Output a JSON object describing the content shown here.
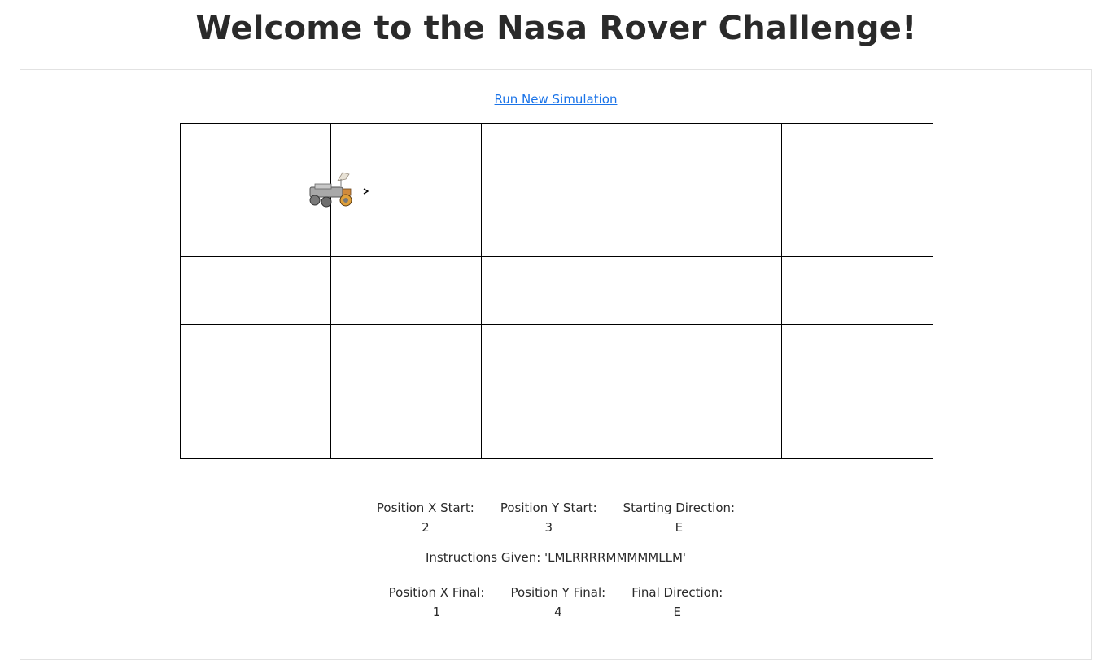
{
  "page": {
    "title": "Welcome to the Nasa Rover Challenge!"
  },
  "actions": {
    "run_label": "Run New Simulation"
  },
  "grid": {
    "columns": 5,
    "rows": 5,
    "rover_direction": "E",
    "rover_icon": "rover-icon"
  },
  "start": {
    "x_label": "Position X Start:",
    "x_value": "2",
    "y_label": "Position Y Start:",
    "y_value": "3",
    "dir_label": "Starting Direction:",
    "dir_value": "E"
  },
  "instructions": {
    "text": "Instructions Given: 'LMLRRRRMMMMMLLM'"
  },
  "final": {
    "x_label": "Position X Final:",
    "x_value": "1",
    "y_label": "Position Y Final:",
    "y_value": "4",
    "dir_label": "Final Direction:",
    "dir_value": "E"
  },
  "colors": {
    "link": "#1a73e8",
    "grid_line": "#000000",
    "panel_border": "#e2e2e2"
  }
}
